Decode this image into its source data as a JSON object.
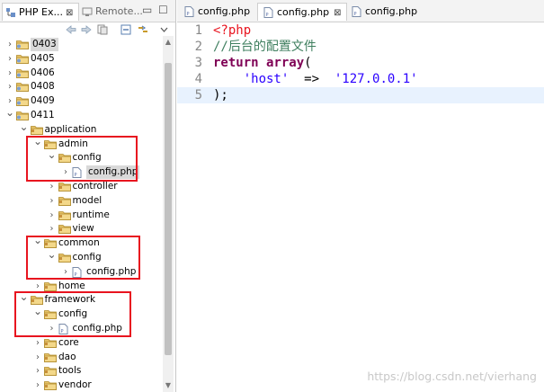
{
  "left_panel": {
    "tabs": [
      {
        "label": "PHP Ex...",
        "active": true,
        "close": "⊠"
      },
      {
        "label": "Remote...",
        "active": false
      }
    ],
    "window_controls": [
      "▭",
      "☐"
    ],
    "toolbar_icons": [
      "back-arrow-icon",
      "forward-arrow-icon",
      "link-editor-icon",
      "collapse-all-icon",
      "link-with-editor-icon",
      "view-menu-icon"
    ]
  },
  "tree": {
    "rows": [
      {
        "label": "0403",
        "depth": 0,
        "type": "project",
        "expanded": false,
        "highlight": true
      },
      {
        "label": "0405",
        "depth": 0,
        "type": "project",
        "expanded": false
      },
      {
        "label": "0406",
        "depth": 0,
        "type": "project",
        "expanded": false
      },
      {
        "label": "0408",
        "depth": 0,
        "type": "project",
        "expanded": false
      },
      {
        "label": "0409",
        "depth": 0,
        "type": "project",
        "expanded": false
      },
      {
        "label": "0411",
        "depth": 0,
        "type": "project",
        "expanded": true
      },
      {
        "label": "application",
        "depth": 1,
        "type": "folder",
        "expanded": true
      },
      {
        "label": "admin",
        "depth": 2,
        "type": "folder",
        "expanded": true
      },
      {
        "label": "config",
        "depth": 3,
        "type": "folder",
        "expanded": true
      },
      {
        "label": "config.php",
        "depth": 4,
        "type": "file",
        "expanded": false,
        "selected": true
      },
      {
        "label": "controller",
        "depth": 3,
        "type": "folder",
        "expanded": false
      },
      {
        "label": "model",
        "depth": 3,
        "type": "folder",
        "expanded": false
      },
      {
        "label": "runtime",
        "depth": 3,
        "type": "folder",
        "expanded": false
      },
      {
        "label": "view",
        "depth": 3,
        "type": "folder",
        "expanded": false
      },
      {
        "label": "common",
        "depth": 2,
        "type": "folder",
        "expanded": true
      },
      {
        "label": "config",
        "depth": 3,
        "type": "folder",
        "expanded": true
      },
      {
        "label": "config.php",
        "depth": 4,
        "type": "file",
        "expanded": false
      },
      {
        "label": "home",
        "depth": 2,
        "type": "folder",
        "expanded": false
      },
      {
        "label": "framework",
        "depth": 1,
        "type": "folder",
        "expanded": true
      },
      {
        "label": "config",
        "depth": 2,
        "type": "folder",
        "expanded": true
      },
      {
        "label": "config.php",
        "depth": 3,
        "type": "file",
        "expanded": false
      },
      {
        "label": "core",
        "depth": 2,
        "type": "folder",
        "expanded": false
      },
      {
        "label": "dao",
        "depth": 2,
        "type": "folder",
        "expanded": false
      },
      {
        "label": "tools",
        "depth": 2,
        "type": "folder",
        "expanded": false
      },
      {
        "label": "vendor",
        "depth": 2,
        "type": "folder",
        "expanded": false
      }
    ]
  },
  "editor": {
    "tabs": [
      {
        "label": "config.php",
        "active": false
      },
      {
        "label": "config.php",
        "active": true,
        "close": "⊠"
      },
      {
        "label": "config.php",
        "active": false
      }
    ],
    "lines": [
      {
        "num": "1",
        "tokens": [
          {
            "t": "<?php",
            "c": "php"
          }
        ]
      },
      {
        "num": "2",
        "tokens": [
          {
            "t": "//后台的配置文件",
            "c": "cm"
          }
        ]
      },
      {
        "num": "3",
        "tokens": [
          {
            "t": "return",
            "c": "k"
          },
          {
            "t": " ",
            "c": ""
          },
          {
            "t": "array",
            "c": "k"
          },
          {
            "t": "(",
            "c": ""
          }
        ]
      },
      {
        "num": "4",
        "tokens": [
          {
            "t": "    ",
            "c": ""
          },
          {
            "t": "'host'",
            "c": "s"
          },
          {
            "t": "  =>  ",
            "c": ""
          },
          {
            "t": "'127.0.0.1'",
            "c": "s"
          }
        ]
      },
      {
        "num": "5",
        "tokens": [
          {
            "t": ");",
            "c": ""
          }
        ],
        "current": true
      }
    ]
  },
  "watermark": "https://blog.csdn.net/vierhang",
  "colors": {
    "annotation_red": "#e8141f",
    "keyword": "#7f0055",
    "string": "#2a00ff",
    "comment": "#3f7f5f",
    "php_tag": "#e8141f"
  }
}
